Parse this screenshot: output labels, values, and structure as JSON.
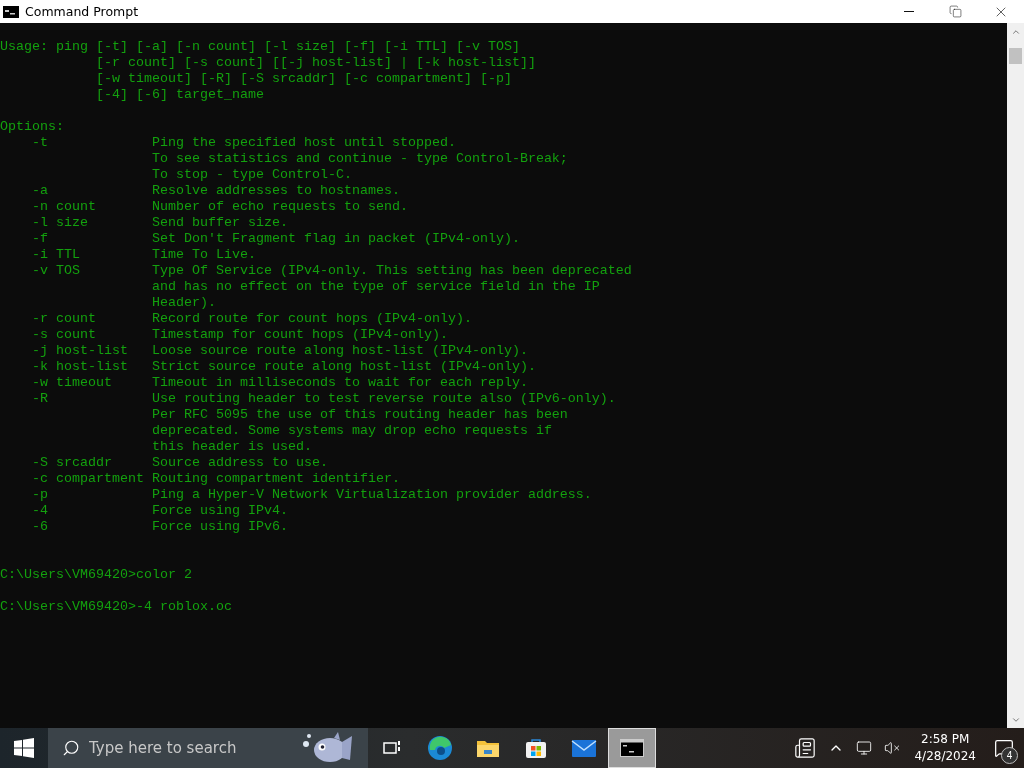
{
  "window": {
    "title": "Command Prompt"
  },
  "console": {
    "blocks": [
      {
        "kind": "output",
        "lines": [
          "Usage: ping [-t] [-a] [-n count] [-l size] [-f] [-i TTL] [-v TOS]",
          "            [-r count] [-s count] [[-j host-list] | [-k host-list]]",
          "            [-w timeout] [-R] [-S srcaddr] [-c compartment] [-p]",
          "            [-4] [-6] target_name"
        ]
      },
      {
        "kind": "output",
        "lines": [
          "Options:",
          "    -t             Ping the specified host until stopped.",
          "                   To see statistics and continue - type Control-Break;",
          "                   To stop - type Control-C.",
          "    -a             Resolve addresses to hostnames.",
          "    -n count       Number of echo requests to send.",
          "    -l size        Send buffer size.",
          "    -f             Set Don't Fragment flag in packet (IPv4-only).",
          "    -i TTL         Time To Live.",
          "    -v TOS         Type Of Service (IPv4-only. This setting has been deprecated",
          "                   and has no effect on the type of service field in the IP",
          "                   Header).",
          "    -r count       Record route for count hops (IPv4-only).",
          "    -s count       Timestamp for count hops (IPv4-only).",
          "    -j host-list   Loose source route along host-list (IPv4-only).",
          "    -k host-list   Strict source route along host-list (IPv4-only).",
          "    -w timeout     Timeout in milliseconds to wait for each reply.",
          "    -R             Use routing header to test reverse route also (IPv6-only).",
          "                   Per RFC 5095 the use of this routing header has been",
          "                   deprecated. Some systems may drop echo requests if",
          "                   this header is used.",
          "    -S srcaddr     Source address to use.",
          "    -c compartment Routing compartment identifier.",
          "    -p             Ping a Hyper-V Network Virtualization provider address.",
          "    -4             Force using IPv4.",
          "    -6             Force using IPv6."
        ]
      },
      {
        "kind": "prompt",
        "lines": [
          "C:\\Users\\VM69420>color 2"
        ]
      },
      {
        "kind": "prompt",
        "lines": [
          "C:\\Users\\VM69420>-4 roblox.oc"
        ]
      }
    ]
  },
  "taskbar": {
    "search": {
      "placeholder": "Type here to search"
    },
    "apps": [
      {
        "kind": "taskview",
        "selected": false
      },
      {
        "kind": "edge",
        "selected": false
      },
      {
        "kind": "explorer",
        "selected": false
      },
      {
        "kind": "store",
        "selected": false
      },
      {
        "kind": "mail",
        "selected": false
      },
      {
        "kind": "terminal",
        "selected": true
      }
    ],
    "clock": {
      "time": "2:58 PM",
      "date": "4/28/2024"
    },
    "notifications": {
      "count": "4"
    }
  }
}
